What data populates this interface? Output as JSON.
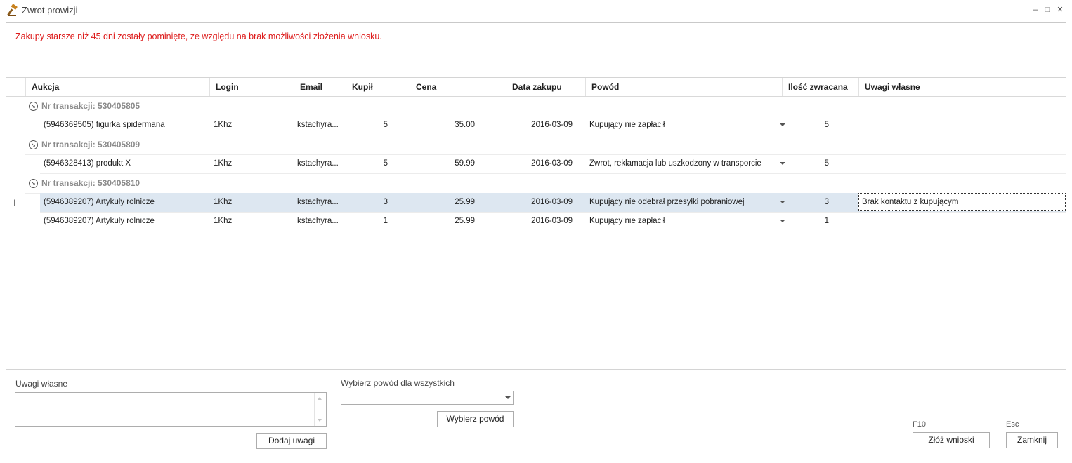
{
  "window": {
    "title": "Zwrot prowizji",
    "icon": "gavel-icon",
    "controls": {
      "minimize": "–",
      "maximize": "□",
      "close": "✕"
    }
  },
  "warning": "Zakupy starsze niż 45 dni zostały pominięte, ze względu na brak możliwości złożenia wniosku.",
  "colors": {
    "warning": "#dd1b1b",
    "selected_row": "#dde7f1",
    "group_text": "#8a8a8a"
  },
  "grid": {
    "columns": {
      "aukcja": "Aukcja",
      "login": "Login",
      "email": "Email",
      "kupil": "Kupił",
      "cena": "Cena",
      "data_zakupu": "Data zakupu",
      "powod": "Powód",
      "ilosc_zwracana": "Ilość zwracana",
      "uwagi_wlasne": "Uwagi własne"
    },
    "groups": [
      {
        "label": "Nr transakcji: 530405805"
      },
      {
        "label": "Nr transakcji: 530405809"
      },
      {
        "label": "Nr transakcji: 530405810"
      }
    ],
    "rows": [
      {
        "aukcja": "(5946369505) figurka spidermana",
        "login": "1Khz",
        "email": "kstachyra...",
        "kupil": "5",
        "cena": "35.00",
        "data": "2016-03-09",
        "powod": "Kupujący nie zapłacił",
        "ilosc": "5",
        "uwagi": ""
      },
      {
        "aukcja": "(5946328413) produkt X",
        "login": "1Khz",
        "email": "kstachyra...",
        "kupil": "5",
        "cena": "59.99",
        "data": "2016-03-09",
        "powod": "Zwrot, reklamacja lub uszkodzony w transporcie",
        "ilosc": "5",
        "uwagi": ""
      },
      {
        "aukcja": "(5946389207) Artykuły rolnicze",
        "login": "1Khz",
        "email": "kstachyra...",
        "kupil": "3",
        "cena": "25.99",
        "data": "2016-03-09",
        "powod": "Kupujący nie odebrał przesyłki pobraniowej",
        "ilosc": "3",
        "uwagi": "Brak kontaktu z kupującym"
      },
      {
        "aukcja": "(5946389207) Artykuły rolnicze",
        "login": "1Khz",
        "email": "kstachyra...",
        "kupil": "1",
        "cena": "25.99",
        "data": "2016-03-09",
        "powod": "Kupujący nie zapłacił",
        "ilosc": "1",
        "uwagi": ""
      }
    ]
  },
  "bottom": {
    "uwagi_label": "Uwagi własne",
    "uwagi_value": "",
    "dodaj_button": "Dodaj uwagi",
    "powod_label": "Wybierz powód dla wszystkich",
    "powod_value": "",
    "wybierz_button": "Wybierz powód",
    "submit_hint": "F10",
    "submit_button": "Złóż wnioski",
    "close_hint": "Esc",
    "close_button": "Zamknij"
  }
}
